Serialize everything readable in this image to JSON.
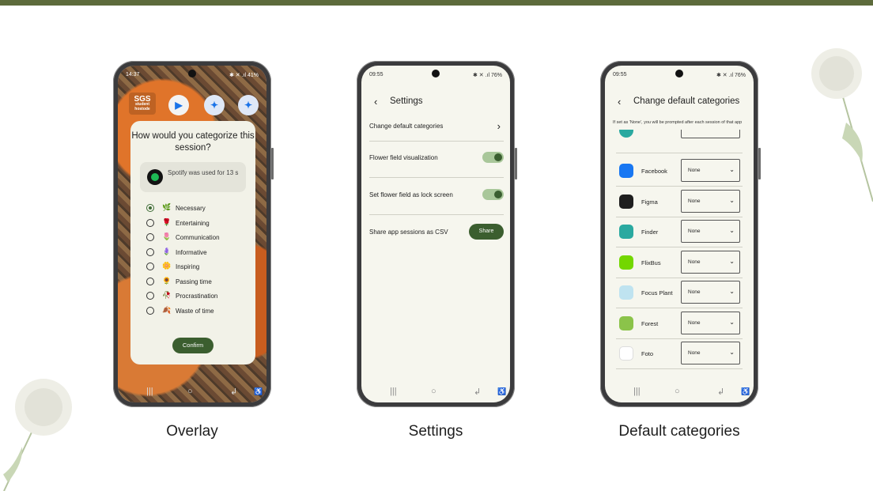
{
  "colors": {
    "top_bar": "#5d6b3c",
    "accent": "#3b5e2f",
    "toggle_track": "#a9c79a"
  },
  "captions": {
    "overlay": "Overlay",
    "settings": "Settings",
    "default_categories": "Default categories"
  },
  "overlay_phone": {
    "status": {
      "time": "14:37",
      "right": "✱ ✕ .ıl 41%"
    },
    "home_logo": "SGS",
    "home_logo_sub1": "student",
    "home_logo_sub2": "hostode",
    "dialog": {
      "title": "How would you categorize this session?",
      "usage_text": "Spotify was used for 13 s",
      "options": [
        {
          "label": "Necessary",
          "flower": "🌿",
          "selected": true
        },
        {
          "label": "Entertaining",
          "flower": "🌹",
          "selected": false
        },
        {
          "label": "Communication",
          "flower": "🌷",
          "selected": false
        },
        {
          "label": "Informative",
          "flower": "🪻",
          "selected": false
        },
        {
          "label": "Inspiring",
          "flower": "🌼",
          "selected": false
        },
        {
          "label": "Passing time",
          "flower": "🌻",
          "selected": false
        },
        {
          "label": "Procrastination",
          "flower": "🥀",
          "selected": false
        },
        {
          "label": "Waste of time",
          "flower": "🍂",
          "selected": false
        }
      ],
      "confirm_label": "Confirm"
    },
    "nav": {
      "recent": "|||",
      "home": "○",
      "back": "↲",
      "a11y": "♿"
    }
  },
  "settings_phone": {
    "status": {
      "time": "09:55",
      "right": "✱ ✕ .ıl 76%"
    },
    "back": "‹",
    "title": "Settings",
    "rows": {
      "change_default": "Change default categories",
      "chevron": "›",
      "flower_viz": "Flower field visualization",
      "lock_screen": "Set flower field as lock screen",
      "share_csv": "Share app sessions as CSV",
      "share_label": "Share"
    },
    "nav": {
      "recent": "|||",
      "home": "○",
      "back": "↲",
      "a11y": "♿"
    }
  },
  "categories_phone": {
    "status": {
      "time": "09:55",
      "right": "✱ ✕ .ıl 76%"
    },
    "back": "‹",
    "title": "Change default categories",
    "note": "If set as 'None', you will be prompted after each session of that app",
    "chevron": "⌄",
    "apps": [
      {
        "name": "Facebook",
        "value": "None",
        "color": "#1877f2"
      },
      {
        "name": "Figma",
        "value": "None",
        "color": "#1e1e1e"
      },
      {
        "name": "Finder",
        "value": "None",
        "color": "#2aa9a0"
      },
      {
        "name": "FlixBus",
        "value": "None",
        "color": "#73d700"
      },
      {
        "name": "Focus Plant",
        "value": "None",
        "color": "#bfe3f0"
      },
      {
        "name": "Forest",
        "value": "None",
        "color": "#8bc34a"
      },
      {
        "name": "Foto",
        "value": "None",
        "color": "#ffffff"
      }
    ],
    "nav": {
      "recent": "|||",
      "home": "○",
      "back": "↲",
      "a11y": "♿"
    }
  }
}
